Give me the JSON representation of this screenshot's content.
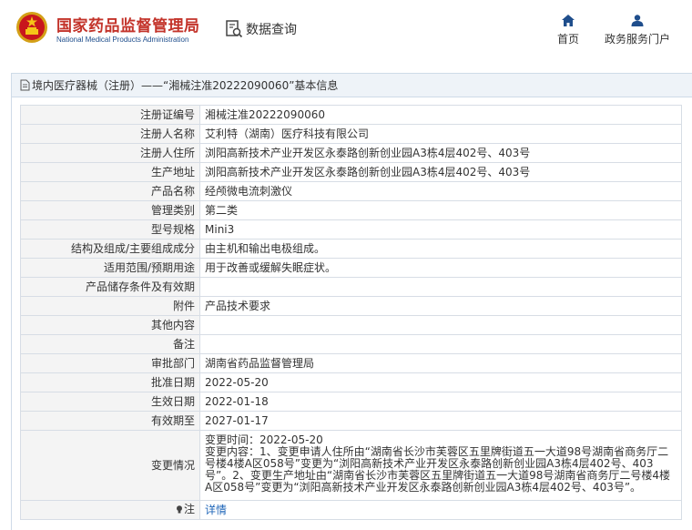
{
  "header": {
    "org_name_cn": "国家药品监督管理局",
    "org_name_en": "National Medical Products Administration",
    "query_label": "数据查询",
    "nav": [
      {
        "label": "首页",
        "icon": "home-icon"
      },
      {
        "label": "政务服务门户",
        "icon": "user-icon"
      }
    ]
  },
  "breadcrumb": "境内医疗器械（注册）——“湘械注准20222090060”基本信息",
  "rows": [
    {
      "label": "注册证编号",
      "value": "湘械注准20222090060"
    },
    {
      "label": "注册人名称",
      "value": "艾利特（湖南）医疗科技有限公司"
    },
    {
      "label": "注册人住所",
      "value": "浏阳高新技术产业开发区永泰路创新创业园A3栋4层402号、403号"
    },
    {
      "label": "生产地址",
      "value": "浏阳高新技术产业开发区永泰路创新创业园A3栋4层402号、403号"
    },
    {
      "label": "产品名称",
      "value": "经颅微电流刺激仪"
    },
    {
      "label": "管理类别",
      "value": "第二类"
    },
    {
      "label": "型号规格",
      "value": "Mini3"
    },
    {
      "label": "结构及组成/主要组成成分",
      "value": "由主机和输出电极组成。"
    },
    {
      "label": "适用范围/预期用途",
      "value": "用于改善或缓解失眠症状。"
    },
    {
      "label": "产品储存条件及有效期",
      "value": ""
    },
    {
      "label": "附件",
      "value": "产品技术要求"
    },
    {
      "label": "其他内容",
      "value": ""
    },
    {
      "label": "备注",
      "value": ""
    },
    {
      "label": "审批部门",
      "value": "湖南省药品监督管理局"
    },
    {
      "label": "批准日期",
      "value": "2022-05-20"
    },
    {
      "label": "生效日期",
      "value": "2022-01-18"
    },
    {
      "label": "有效期至",
      "value": "2027-01-17"
    }
  ],
  "change": {
    "label": "变更情况",
    "time": "变更时间：2022-05-20",
    "content": "变更内容：1、变更申请人住所由“湖南省长沙市芙蓉区五里牌街道五一大道98号湖南省商务厅二号楼4楼A区058号”变更为“浏阳高新技术产业开发区永泰路创新创业园A3栋4层402号、403号”。2、变更生产地址由“湖南省长沙市芙蓉区五里牌街道五一大道98号湖南省商务厅二号楼4楼A区058号”变更为“浏阳高新技术产业开发区永泰路创新创业园A3栋4层402号、403号”。"
  },
  "note": {
    "label": "注",
    "link": "详情"
  },
  "colors": {
    "brand_red": "#c3332a",
    "nav_blue": "#1f4e8c",
    "link_blue": "#1f66b8"
  }
}
